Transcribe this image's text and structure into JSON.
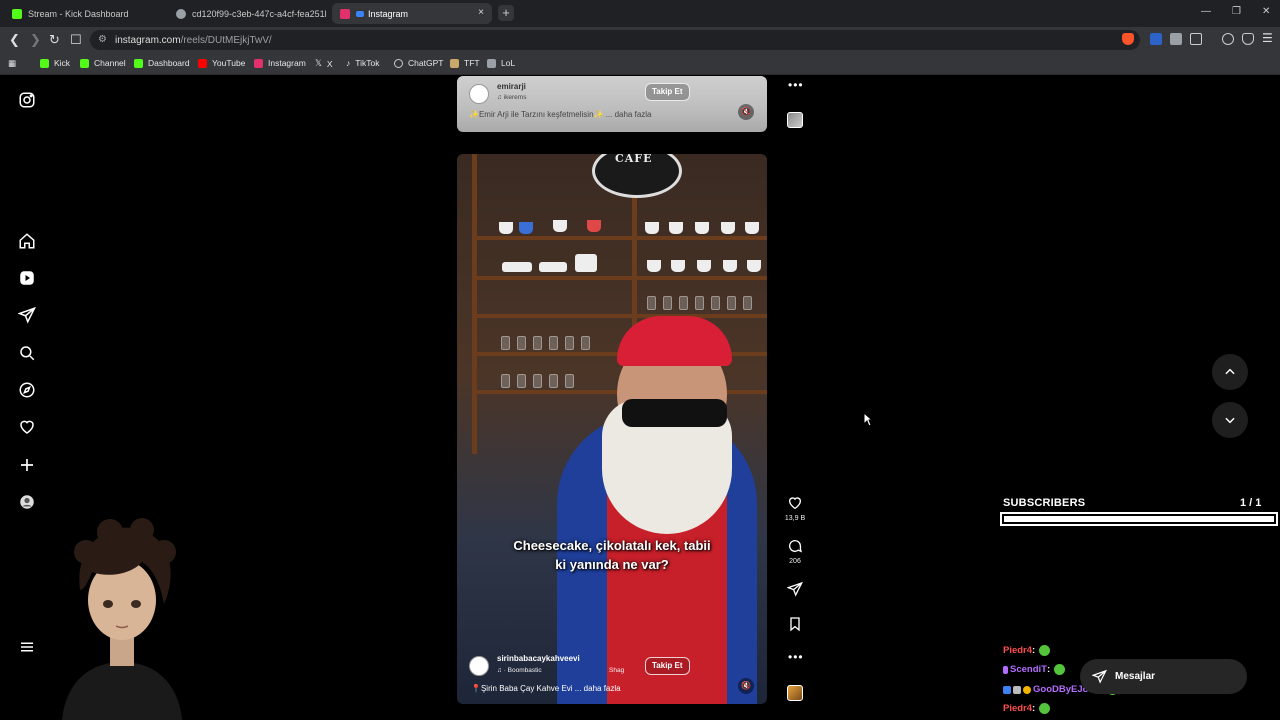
{
  "browser": {
    "tabs": [
      {
        "label": "Stream - Kick Dashboard",
        "color": "#53fc18"
      },
      {
        "label": "cd120f99-c3eb-447c-a4cf-fea251b1",
        "color": "#9aa0a6"
      },
      {
        "label": "Instagram",
        "color": "#e1306c"
      }
    ],
    "close_tab": "×",
    "new_tab": "+",
    "url_host": "instagram.com",
    "url_path": "/reels/DUtMEjkjTwV/",
    "bookmarks": [
      {
        "label": "Kick",
        "color": "#53fc18"
      },
      {
        "label": "Channel",
        "color": "#53fc18"
      },
      {
        "label": "Dashboard",
        "color": "#53fc18"
      },
      {
        "label": "YouTube",
        "color": "#ff0000"
      },
      {
        "label": "Instagram",
        "color": "#e1306c"
      },
      {
        "label": "X",
        "color": "#ffffff"
      },
      {
        "label": "TikTok",
        "color": "#ffffff"
      },
      {
        "label": "ChatGPT",
        "color": "#cccccc"
      },
      {
        "label": "TFT",
        "color": "#c8a96b"
      },
      {
        "label": "LoL",
        "color": "#9aa0a6"
      }
    ]
  },
  "reel_previous": {
    "username": "emirarji",
    "audio": "ikerems",
    "follow_label": "Takip Et",
    "caption": "✨Emir Arji ile Tarzını keşfetmelisin✨ ... daha fazla"
  },
  "reel_current": {
    "sign_text": "CAFE",
    "subtitle_text": "Cheesecake, çikolatalı kek, tabii ki yanında ne var?",
    "username": "sirinbabacaykahveevi",
    "audio": "· Boombastic",
    "audio_extra": "Shag",
    "follow_label": "Takip Et",
    "caption": "📍Şirin Baba Çay Kahve Evi ... daha fazla",
    "likes": "13,9 B",
    "comments": "206"
  },
  "overlay": {
    "subs_label": "SUBSCRIBERS",
    "subs_count": "1 / 1",
    "subs_progress": 1.0,
    "chat": [
      {
        "user": "Piedr4",
        "sep": " :",
        "color": "#ff4d4d"
      },
      {
        "user": "ScendiT",
        "sep": " :",
        "color": "#b46cff"
      },
      {
        "user": "GooDByEJoJo",
        "sep": " :",
        "color": "#b46cff"
      },
      {
        "user": "Piedr4",
        "sep": " :",
        "color": "#ff4d4d"
      }
    ],
    "messages_label": "Mesajlar"
  },
  "colors": {
    "accent_kick": "#53fc18",
    "instagram": "#e1306c"
  }
}
